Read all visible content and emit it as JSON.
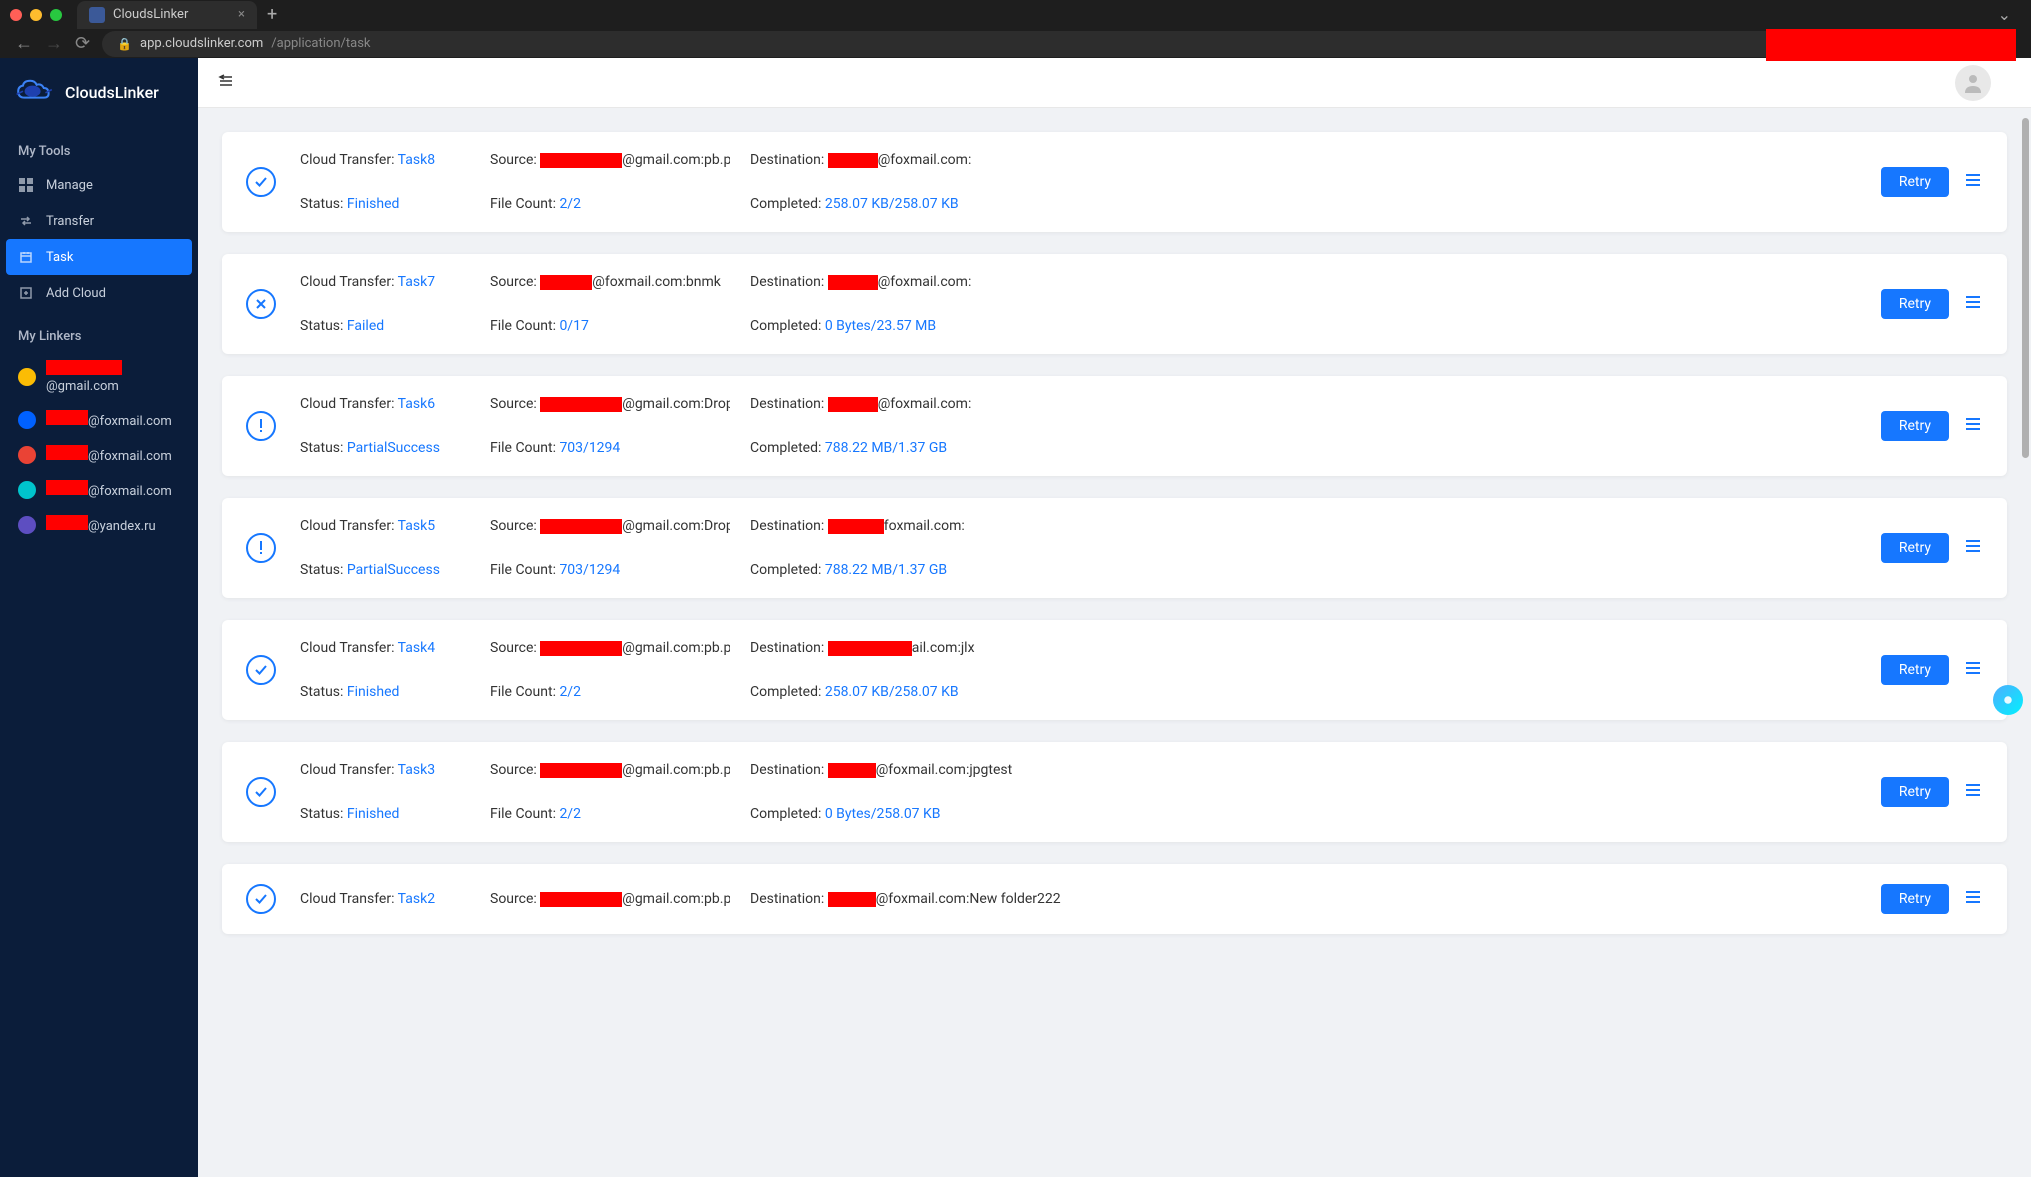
{
  "browser": {
    "tab_title": "CloudsLinker",
    "url_host": "app.cloudslinker.com",
    "url_path": "/application/task"
  },
  "sidebar": {
    "brand": "CloudsLinker",
    "section_tools": "My Tools",
    "section_linkers": "My Linkers",
    "nav": {
      "manage": "Manage",
      "transfer": "Transfer",
      "task": "Task",
      "add_cloud": "Add Cloud"
    },
    "linkers": [
      {
        "suffix": "@gmail.com",
        "icon_color": "#fbbc04",
        "redact_width": 76
      },
      {
        "suffix": "@foxmail.com",
        "icon_color": "#0061ff",
        "redact_width": 42
      },
      {
        "suffix": "@foxmail.com",
        "icon_color": "#ea4335",
        "redact_width": 42
      },
      {
        "suffix": "@foxmail.com",
        "icon_color": "#00c4cc",
        "redact_width": 42
      },
      {
        "suffix": "@yandex.ru",
        "icon_color": "#5d4ec1",
        "redact_width": 42
      }
    ]
  },
  "labels": {
    "cloud_transfer": "Cloud Transfer:",
    "source": "Source:",
    "destination": "Destination:",
    "status": "Status:",
    "file_count": "File Count:",
    "completed": "Completed:",
    "retry": "Retry"
  },
  "tasks": [
    {
      "name": "Task8",
      "status": "Finished",
      "status_type": "success",
      "source_suffix": "@gmail.com:pb.png",
      "dest_suffix": "@foxmail.com:",
      "source_redact": 82,
      "dest_redact": 50,
      "file_count": "2/2",
      "completed": "258.07 KB/258.07 KB"
    },
    {
      "name": "Task7",
      "status": "Failed",
      "status_type": "failed",
      "source_suffix": "@foxmail.com:bnmk",
      "dest_suffix": "@foxmail.com:",
      "source_redact": 52,
      "dest_redact": 50,
      "file_count": "0/17",
      "completed": "0 Bytes/23.57 MB"
    },
    {
      "name": "Task6",
      "status": "PartialSuccess",
      "status_type": "partial",
      "source_suffix": "@gmail.com:Dropbox",
      "dest_suffix": "@foxmail.com:",
      "source_redact": 82,
      "dest_redact": 50,
      "file_count": "703/1294",
      "completed": "788.22 MB/1.37 GB"
    },
    {
      "name": "Task5",
      "status": "PartialSuccess",
      "status_type": "partial",
      "source_suffix": "@gmail.com:Dropbox",
      "dest_suffix": "foxmail.com:",
      "source_redact": 82,
      "dest_redact": 56,
      "file_count": "703/1294",
      "completed": "788.22 MB/1.37 GB"
    },
    {
      "name": "Task4",
      "status": "Finished",
      "status_type": "success",
      "source_suffix": "@gmail.com:pb.png",
      "dest_suffix": "ail.com:jlx",
      "source_redact": 82,
      "dest_redact": 84,
      "file_count": "2/2",
      "completed": "258.07 KB/258.07 KB"
    },
    {
      "name": "Task3",
      "status": "Finished",
      "status_type": "success",
      "source_suffix": "@gmail.com:pb.png",
      "dest_suffix": "@foxmail.com:jpgtest",
      "source_redact": 82,
      "dest_redact": 48,
      "file_count": "2/2",
      "completed": "0 Bytes/258.07 KB"
    },
    {
      "name": "Task2",
      "status": "",
      "status_type": "success",
      "source_suffix": "@gmail.com:pb.png",
      "dest_suffix": "@foxmail.com:New folder222",
      "source_redact": 82,
      "dest_redact": 48,
      "file_count": "",
      "completed": ""
    }
  ]
}
